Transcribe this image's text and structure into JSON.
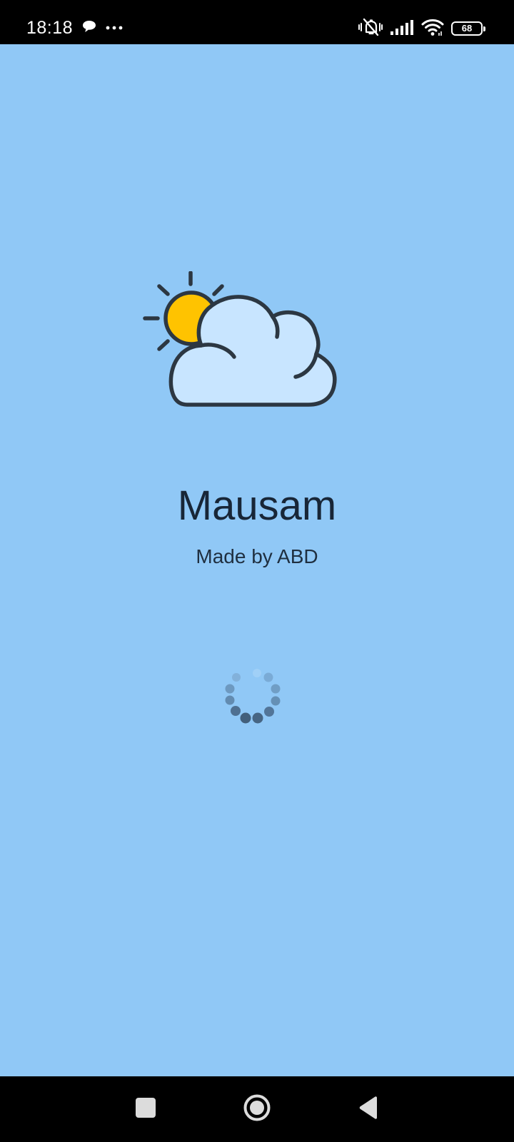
{
  "status_bar": {
    "time": "18:18",
    "left_icons": [
      "chat-bubble-icon",
      "more-dots-icon"
    ],
    "right_icons": [
      "vibrate-silent-icon",
      "signal-icon",
      "wifi-icon",
      "battery-icon"
    ],
    "battery_level": "68"
  },
  "app": {
    "name": "Mausam",
    "subtitle": "Made by ABD",
    "logo_icon": "partly-cloudy-icon",
    "background_color": "#90c8f6",
    "sun_color": "#ffc300",
    "cloud_color": "#c8e5ff"
  },
  "loading": {
    "icon": "loading-spinner-icon"
  },
  "nav_bar": {
    "buttons": [
      "recents-square-icon",
      "home-circle-icon",
      "back-triangle-icon"
    ]
  }
}
